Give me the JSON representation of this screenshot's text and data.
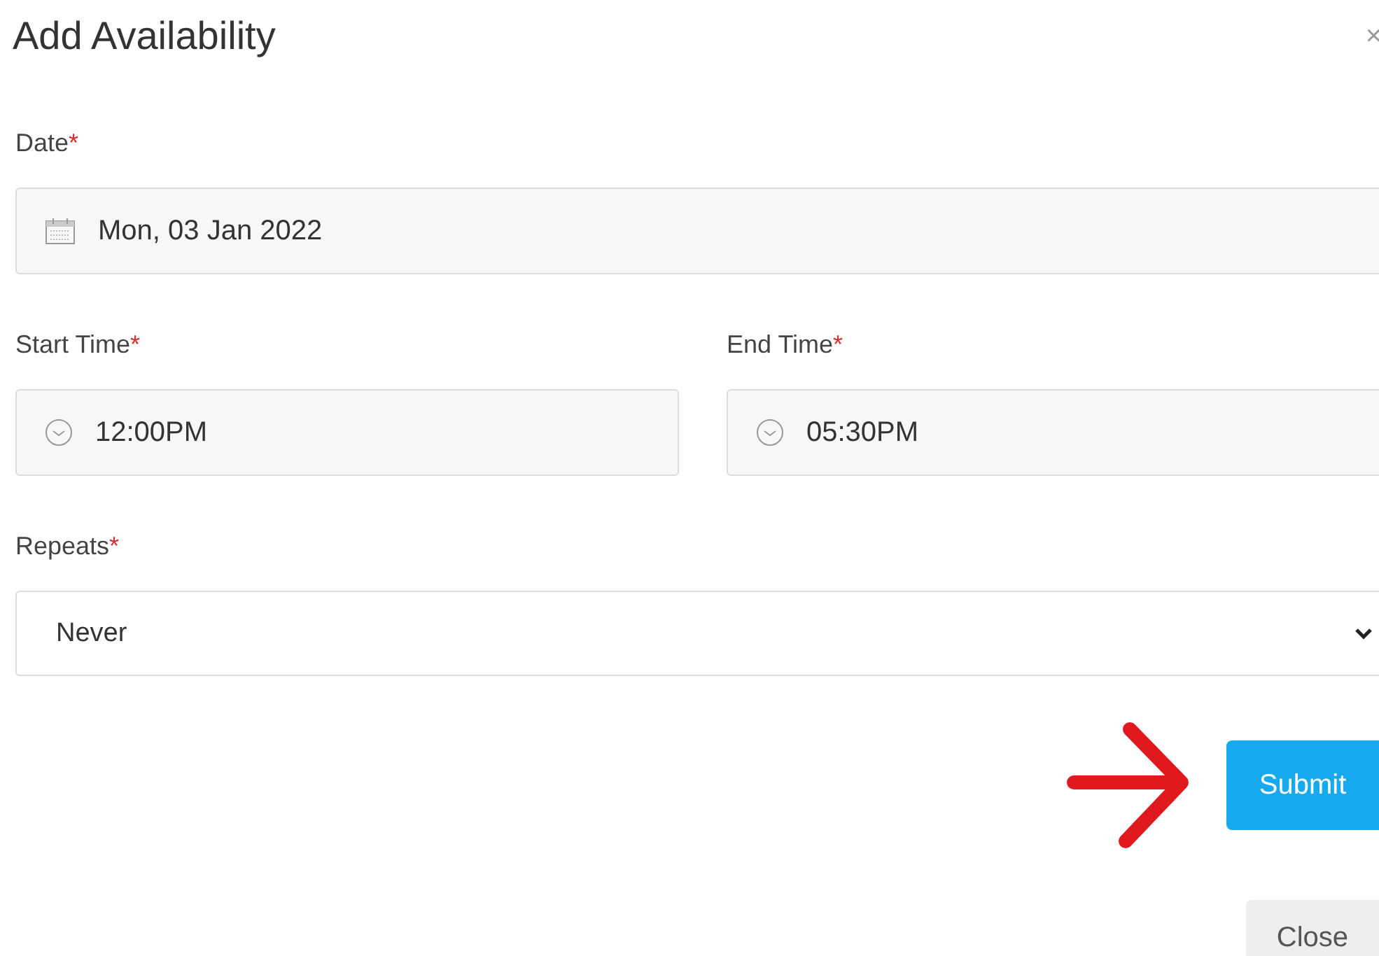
{
  "dialog": {
    "title": "Add Availability",
    "close_glyph": "×"
  },
  "fields": [
    {
      "label": "Date",
      "required_mark": "*",
      "value": "Mon, 03 Jan 2022",
      "kind": "date"
    }
  ],
  "time_fields": [
    {
      "label": "Start Time",
      "required_mark": "*",
      "value": "12:00PM",
      "kind": "time"
    },
    {
      "label": "End Time",
      "required_mark": "*",
      "value": "05:30PM",
      "kind": "time"
    }
  ],
  "repeats": {
    "label": "Repeats",
    "required_mark": "*",
    "value": "Never"
  },
  "buttons": [
    {
      "label": "Submit",
      "kind": "primary"
    },
    {
      "label": "Close",
      "kind": "secondary"
    }
  ]
}
